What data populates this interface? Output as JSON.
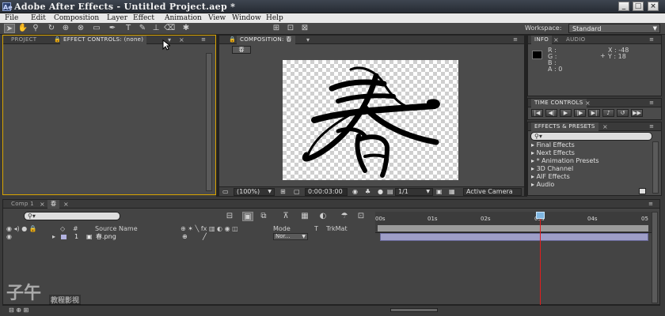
{
  "window": {
    "title": "Adobe After Effects - Untitled Project.aep *",
    "app_icon_text": "Ae"
  },
  "menu": [
    "File",
    "Edit",
    "Composition",
    "Layer",
    "Effect",
    "Animation",
    "View",
    "Window",
    "Help"
  ],
  "toolbar": {
    "workspace_label": "Workspace:",
    "workspace_value": "Standard"
  },
  "left_panel": {
    "tabs": [
      "PROJECT",
      "EFFECT CONTROLS: (none)"
    ]
  },
  "composition_panel": {
    "tab": "COMPOSITION: 春",
    "subtab": "春",
    "footer": {
      "zoom": "(100%)",
      "timecode": "0:00:03:00",
      "resolution": "1/1",
      "camera": "Active Camera"
    }
  },
  "info_panel": {
    "tabs": [
      "INFO",
      "AUDIO"
    ],
    "r": "R :",
    "g": "G :",
    "b": "B :",
    "a": "A : 0",
    "x": "X : -48",
    "y": "Y : 18"
  },
  "time_controls": {
    "title": "TIME CONTROLS"
  },
  "effects_presets": {
    "title": "EFFECTS & PRESETS",
    "search_icon": "search-icon",
    "items": [
      "Final Effects",
      "Next Effects",
      "* Animation Presets",
      "3D Channel",
      "AIF Effects",
      "Audio"
    ]
  },
  "timeline": {
    "tabs": [
      "Comp 1",
      "春"
    ],
    "columns": {
      "source_name": "Source Name",
      "mode": "Mode",
      "t": "T",
      "trkmat": "TrkMat"
    },
    "layer": {
      "index": "1",
      "name": "春.png",
      "mode": "Nor..."
    },
    "ticks": [
      "00s",
      "01s",
      "02s",
      "03s",
      "04s",
      "05"
    ]
  },
  "watermark": {
    "text": "子午",
    "subtext": "教程影视"
  },
  "colors": {
    "panel_bg": "#4b4b4b",
    "active_tab_border": "#d9a400",
    "cti_red": "#e21e1e",
    "layer_bar": "#9e9ec8"
  }
}
